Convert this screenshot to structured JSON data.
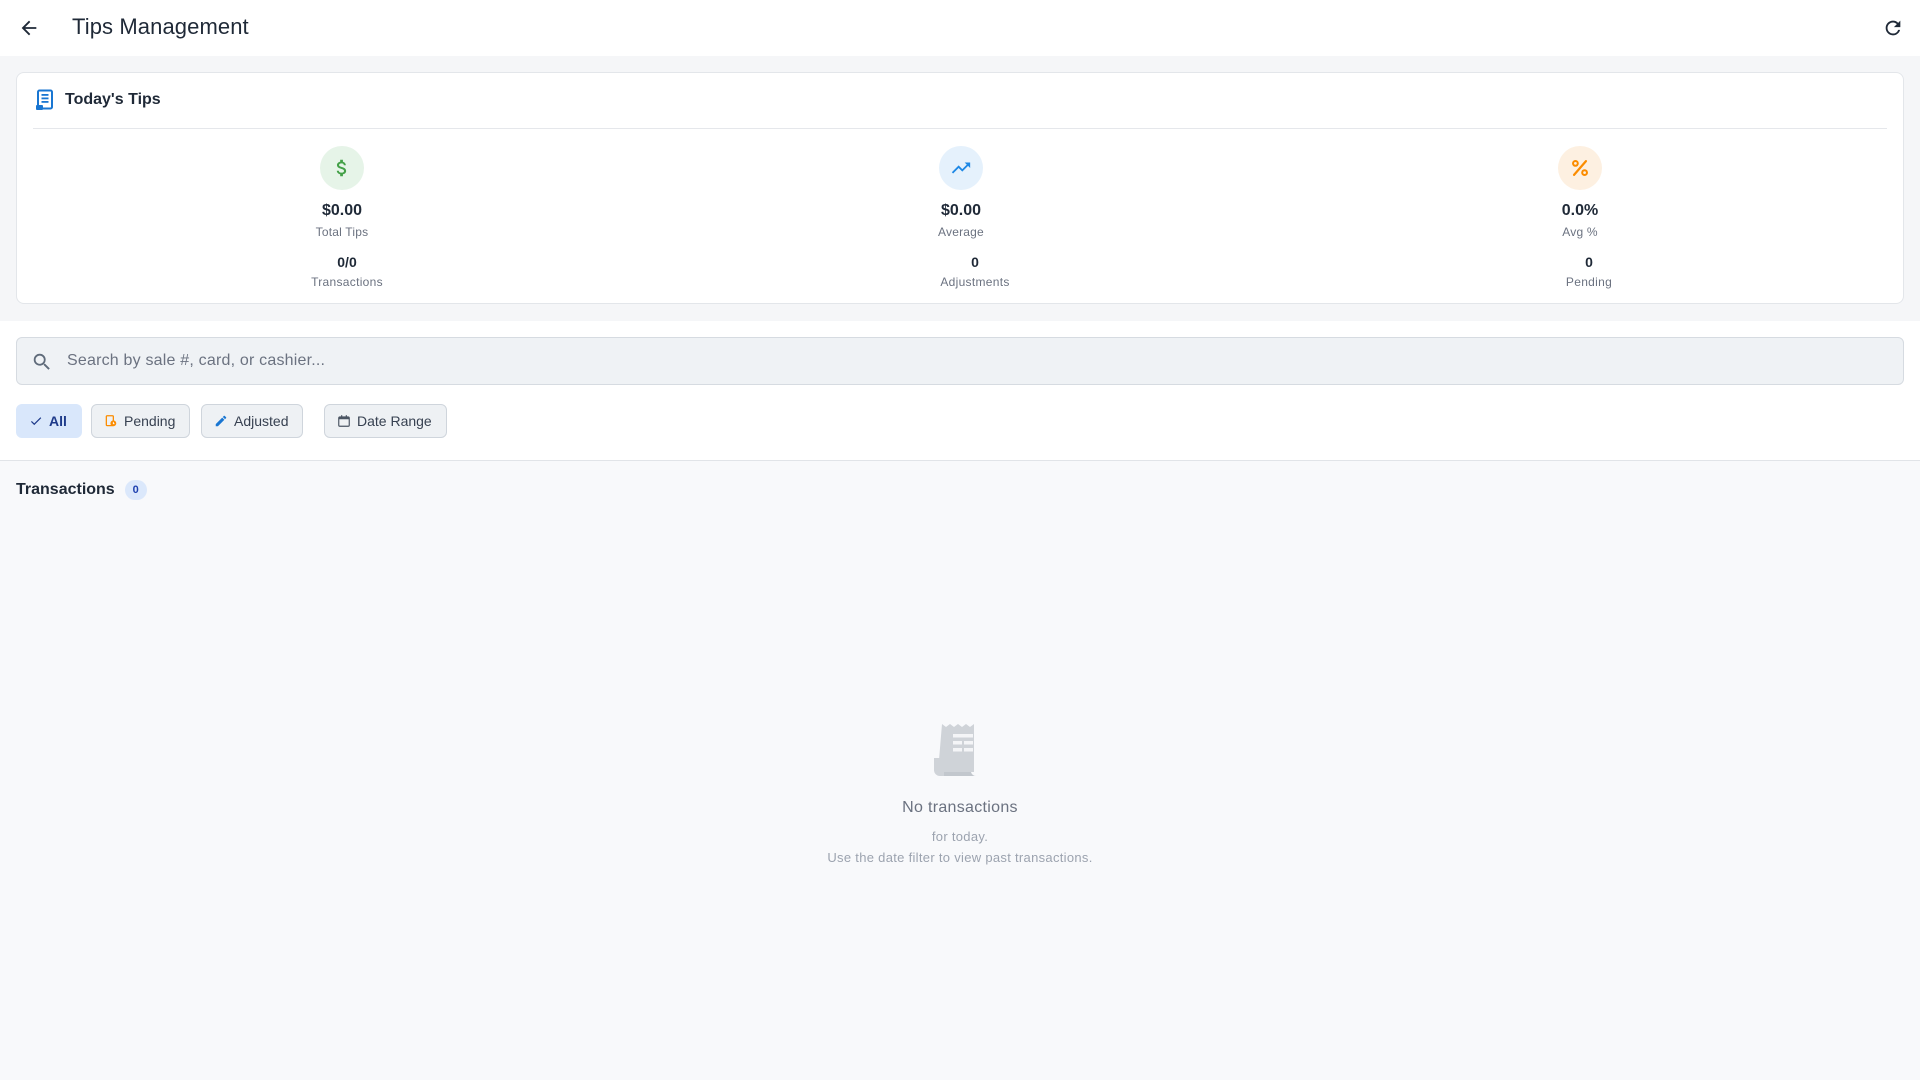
{
  "header": {
    "title": "Tips Management",
    "back_icon": "arrow-left-icon",
    "refresh_icon": "refresh-icon"
  },
  "summary": {
    "title": "Today's Tips",
    "icon": "receipt-icon",
    "stats": [
      {
        "value": "$0.00",
        "label": "Total Tips",
        "icon": "dollar-icon",
        "color": "#43a047",
        "bg": "#e6f4e8"
      },
      {
        "value": "$0.00",
        "label": "Average",
        "icon": "trending-up-icon",
        "color": "#1e88e5",
        "bg": "#e5f1fc"
      },
      {
        "value": "0.0%",
        "label": "Avg %",
        "icon": "percent-icon",
        "color": "#fb8c00",
        "bg": "#fdf0e1"
      }
    ],
    "sub_stats": [
      {
        "value": "0/0",
        "label": "Transactions"
      },
      {
        "value": "0",
        "label": "Adjustments"
      },
      {
        "value": "0",
        "label": "Pending"
      }
    ]
  },
  "search": {
    "placeholder": "Search by sale #, card, or cashier...",
    "value": ""
  },
  "filters": [
    {
      "label": "All",
      "icon": "check-icon",
      "selected": true
    },
    {
      "label": "Pending",
      "icon": "pending-icon",
      "selected": false
    },
    {
      "label": "Adjusted",
      "icon": "edit-icon",
      "selected": false
    },
    {
      "label": "Date Range",
      "icon": "calendar-icon",
      "selected": false
    }
  ],
  "transactions": {
    "title": "Transactions",
    "count": "0",
    "empty": {
      "icon": "receipt-icon",
      "title": "No transactions",
      "line1": "for today.",
      "line2": "Use the date filter to view past transactions."
    }
  },
  "colors": {
    "accent": "#1976d2",
    "chip_selected_bg": "#d9e7fb"
  }
}
